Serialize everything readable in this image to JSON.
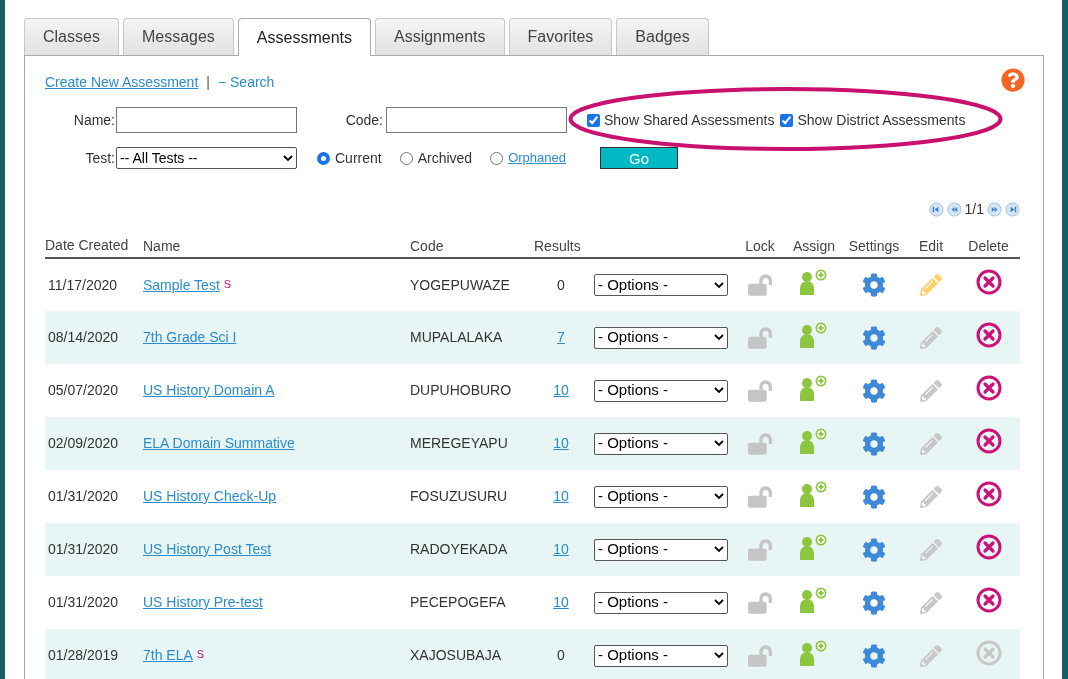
{
  "tabs": [
    {
      "label": "Classes",
      "selected": false
    },
    {
      "label": "Messages",
      "selected": false
    },
    {
      "label": "Assessments",
      "selected": true
    },
    {
      "label": "Assignments",
      "selected": false
    },
    {
      "label": "Favorites",
      "selected": false
    },
    {
      "label": "Badges",
      "selected": false
    }
  ],
  "links": {
    "create": "Create New Assessment",
    "separator": "|",
    "search": "− Search"
  },
  "filters": {
    "name_label": "Name:",
    "code_label": "Code:",
    "checkboxes": [
      {
        "label": "Show Shared Assessments",
        "checked": true
      },
      {
        "label": "Show District Assessments",
        "checked": true
      }
    ],
    "test_label": "Test:",
    "test_value": "-- All Tests --",
    "radios": [
      {
        "label": "Current",
        "selected": true,
        "linked": false
      },
      {
        "label": "Archived",
        "selected": false,
        "linked": false
      },
      {
        "label": "Orphaned",
        "selected": false,
        "linked": true
      }
    ],
    "go_button": "Go"
  },
  "pagination": "1/1",
  "columns": {
    "date": "Date Created",
    "name": "Name",
    "code": "Code",
    "results": "Results",
    "lock": "Lock",
    "assign": "Assign",
    "settings": "Settings",
    "edit": "Edit",
    "delete": "Delete"
  },
  "rows": [
    {
      "date": "11/17/2020",
      "name": "Sample Test",
      "badge": "S",
      "code": "YOGEPUWAZE",
      "results": "0",
      "results_linked": false,
      "options": "- Options -",
      "editable": true,
      "deletable": true
    },
    {
      "date": "08/14/2020",
      "name": "7th Grade Sci I",
      "code": "MUPALALAKA",
      "results": "7",
      "results_linked": true,
      "options": "- Options -",
      "editable": false,
      "deletable": true
    },
    {
      "date": "05/07/2020",
      "name": "US History Domain A",
      "code": "DUPUHOBURO",
      "results": "10",
      "results_linked": true,
      "options": "- Options -",
      "editable": false,
      "deletable": true
    },
    {
      "date": "02/09/2020",
      "name": "ELA Domain Summative",
      "code": "MEREGEYAPU",
      "results": "10",
      "results_linked": true,
      "options": "- Options -",
      "editable": false,
      "deletable": true
    },
    {
      "date": "01/31/2020",
      "name": "US History Check-Up",
      "code": "FOSUZUSURU",
      "results": "10",
      "results_linked": true,
      "options": "- Options -",
      "editable": false,
      "deletable": true
    },
    {
      "date": "01/31/2020",
      "name": "US History Post Test",
      "code": "RADOYEKADA",
      "results": "10",
      "results_linked": true,
      "options": "- Options -",
      "editable": false,
      "deletable": true
    },
    {
      "date": "01/31/2020",
      "name": "US History Pre-test",
      "code": "PECEPOGEFA",
      "results": "10",
      "results_linked": true,
      "options": "- Options -",
      "editable": false,
      "deletable": true
    },
    {
      "date": "01/28/2019",
      "name": "7th ELA",
      "badge": "S",
      "code": "XAJOSUBAJA",
      "results": "0",
      "results_linked": false,
      "options": "- Options -",
      "editable": false,
      "deletable": false
    }
  ]
}
